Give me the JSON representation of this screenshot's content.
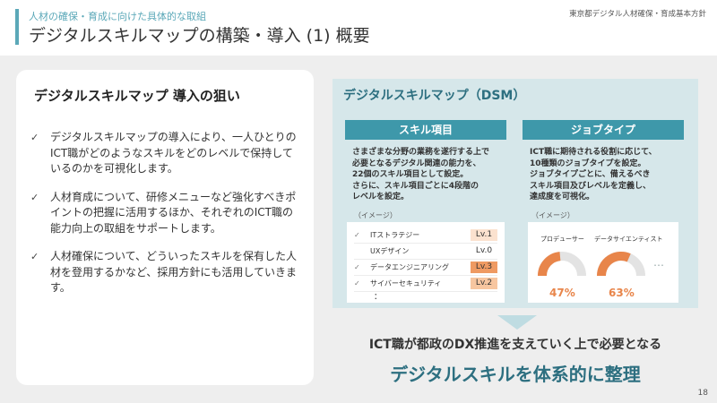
{
  "header": {
    "subtitle": "人材の確保・育成に向けた具体的な取組",
    "title": "デジタルスキルマップの構築・導入 (1) 概要",
    "right_label": "東京都デジタル人材確保・育成基本方針"
  },
  "left_card": {
    "title": "デジタルスキルマップ 導入の狙い",
    "bullets": [
      "デジタルスキルマップの導入により、一人ひとりのICT職がどのようなスキルをどのレベルで保持しているのかを可視化します。",
      "人材育成について、研修メニューなど強化すべきポイントの把握に活用するほか、それぞれのICT職の能力向上の取組をサポートします。",
      "人材確保について、どういったスキルを保有した人材を登用するかなど、採用方針にも活用していきます。"
    ]
  },
  "dsm": {
    "title": "デジタルスキルマップ（DSM）",
    "skill_column": {
      "header": "スキル項目",
      "desc_lines": [
        "さまざまな分野の業務を遂行する上で",
        "必要となるデジタル関連の能力を、",
        "22個のスキル項目として設定。",
        "さらに、スキル項目ごとに4段階の",
        "レベルを設定。"
      ],
      "image_label": "（イメージ）",
      "skills": [
        {
          "checked": true,
          "name": "ITストラテジー",
          "level": "Lv.1"
        },
        {
          "checked": false,
          "name": "UXデザイン",
          "level": "Lv.0"
        },
        {
          "checked": true,
          "name": "データエンジニアリング",
          "level": "Lv.3"
        },
        {
          "checked": true,
          "name": "サイバーセキュリティ",
          "level": "Lv.2"
        }
      ],
      "ellipsis": "："
    },
    "job_column": {
      "header": "ジョブタイプ",
      "desc_lines": [
        "ICT職に期待される役割に応じて、",
        "10種類のジョブタイプを設定。",
        "ジョブタイプごとに、備えるべき",
        "スキル項目及びレベルを定義し、",
        "達成度を可視化。"
      ],
      "image_label": "（イメージ）",
      "jobs": [
        {
          "name": "プロデューサー",
          "value": "47%",
          "percent": 0.47
        },
        {
          "name": "データサイエンティスト",
          "value": "63%",
          "percent": 0.63
        }
      ],
      "more": "…"
    }
  },
  "conclusion": {
    "line1": "ICT職が都政のDX推進を支えていく上で必要となる",
    "line2": "デジタルスキルを体系的に整理"
  },
  "page_number": "18",
  "colors": {
    "accent": "#5ba8b8",
    "column_header": "#3e98aa",
    "gauge": "#e8854a",
    "gauge_track": "#e3e3e3"
  }
}
